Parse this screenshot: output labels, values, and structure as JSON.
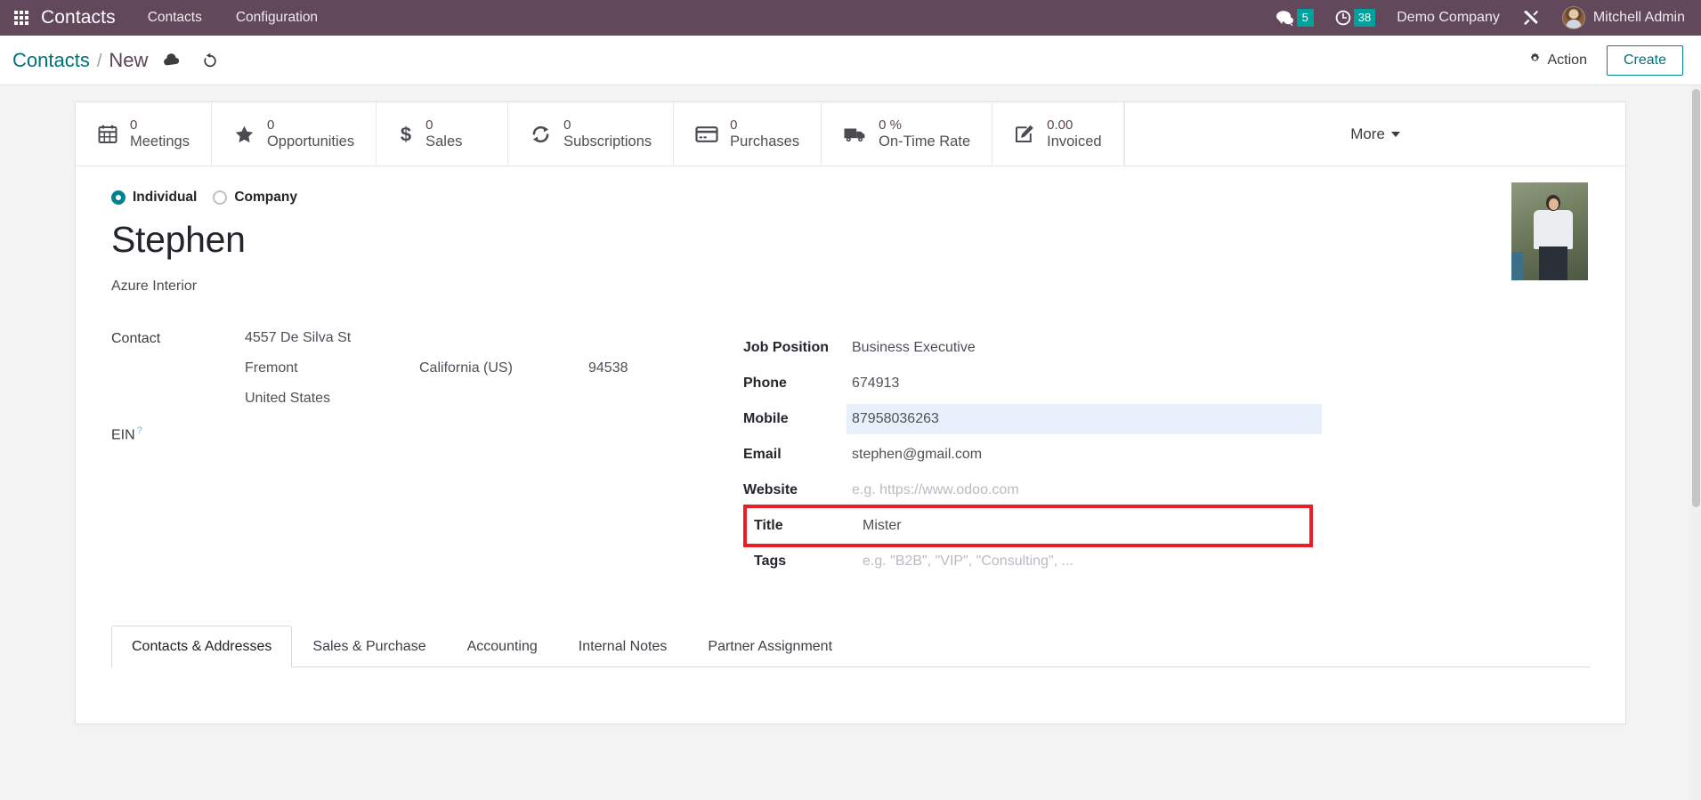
{
  "navbar": {
    "apps_icon": "apps-grid-icon",
    "brand": "Contacts",
    "menu": [
      {
        "label": "Contacts"
      },
      {
        "label": "Configuration"
      }
    ],
    "messages_icon": "chat-bubble-icon",
    "messages_count": "5",
    "activities_icon": "clock-icon",
    "activities_count": "38",
    "company": "Demo Company",
    "tools_icon": "wrench-screwdriver-icon",
    "user": "Mitchell Admin",
    "avatar_icon": "user-avatar",
    "accent": "#00a09d",
    "background": "#5c4356"
  },
  "control_panel": {
    "breadcrumb_root": "Contacts",
    "breadcrumb_separator": "/",
    "breadcrumb_current": "New",
    "save_icon": "cloud-upload-icon",
    "discard_icon": "undo-icon",
    "action_icon": "gear-icon",
    "action_label": "Action",
    "create_label": "Create",
    "link_color": "#00727c"
  },
  "stat_buttons": [
    {
      "icon": "calendar-icon",
      "value": "0",
      "label": "Meetings"
    },
    {
      "icon": "star-icon",
      "value": "0",
      "label": "Opportunities"
    },
    {
      "icon": "dollar-icon",
      "value": "0",
      "label": "Sales"
    },
    {
      "icon": "refresh-icon",
      "value": "0",
      "label": "Subscriptions"
    },
    {
      "icon": "credit-card-icon",
      "value": "0",
      "label": "Purchases"
    },
    {
      "icon": "truck-icon",
      "value": "0 %",
      "label": "On-Time Rate"
    },
    {
      "icon": "pencil-square-icon",
      "value": "0.00",
      "label": "Invoiced"
    }
  ],
  "more_button": {
    "label": "More",
    "icon": "caret-down-icon"
  },
  "form": {
    "type_options": [
      {
        "label": "Individual",
        "selected": true
      },
      {
        "label": "Company",
        "selected": false
      }
    ],
    "name": "Stephen",
    "parent_company": "Azure Interior",
    "photo_icon": "contact-photo",
    "left": {
      "contact_label": "Contact",
      "street": "4557 De Silva St",
      "city": "Fremont",
      "state": "California (US)",
      "zip": "94538",
      "country": "United States",
      "ein_label": "EIN",
      "ein_help_icon": "question-mark-icon",
      "ein_value": ""
    },
    "right": [
      {
        "label": "Job Position",
        "value": "Business Executive",
        "placeholder": "",
        "highlight": false,
        "boxed": false
      },
      {
        "label": "Phone",
        "value": "674913",
        "placeholder": "",
        "highlight": false,
        "boxed": false
      },
      {
        "label": "Mobile",
        "value": "87958036263",
        "placeholder": "",
        "highlight": true,
        "boxed": false
      },
      {
        "label": "Email",
        "value": "stephen@gmail.com",
        "placeholder": "",
        "highlight": false,
        "boxed": false
      },
      {
        "label": "Website",
        "value": "",
        "placeholder": "e.g. https://www.odoo.com",
        "highlight": false,
        "boxed": false
      },
      {
        "label": "Title",
        "value": "Mister",
        "placeholder": "",
        "highlight": false,
        "boxed": true
      },
      {
        "label": "Tags",
        "value": "",
        "placeholder": "e.g. \"B2B\", \"VIP\", \"Consulting\", ...",
        "highlight": false,
        "boxed": false
      }
    ],
    "highlight_box_color": "#ee1c23"
  },
  "notebook": {
    "tabs": [
      {
        "label": "Contacts & Addresses",
        "active": true
      },
      {
        "label": "Sales & Purchase",
        "active": false
      },
      {
        "label": "Accounting",
        "active": false
      },
      {
        "label": "Internal Notes",
        "active": false
      },
      {
        "label": "Partner Assignment",
        "active": false
      }
    ]
  }
}
